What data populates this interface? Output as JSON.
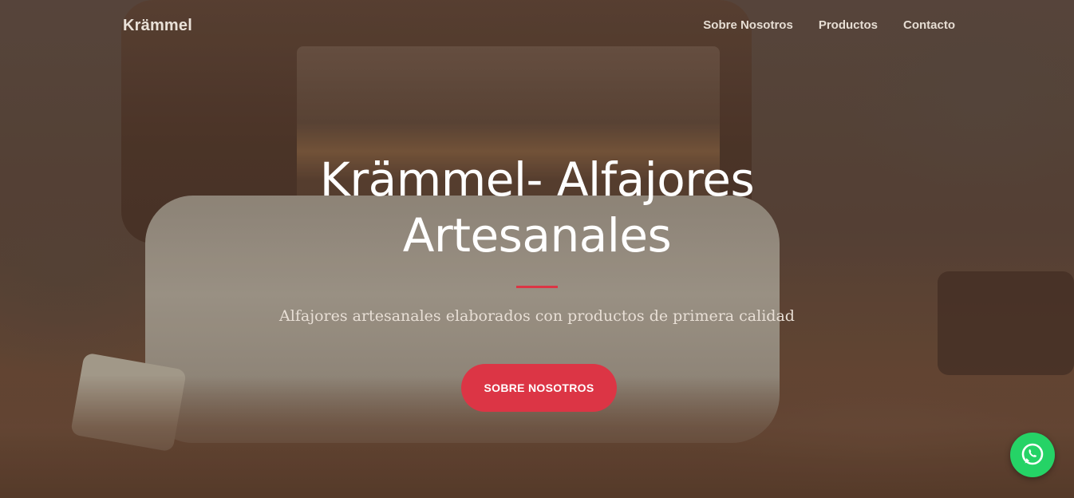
{
  "nav": {
    "brand": "Krämmel",
    "links": [
      {
        "label": "Sobre Nosotros"
      },
      {
        "label": "Productos"
      },
      {
        "label": "Contacto"
      }
    ]
  },
  "hero": {
    "title": "Krämmel- Alfajores Artesanales",
    "subtitle": "Alfajores artesanales elaborados con productos de primera calidad",
    "cta_label": "SOBRE NOSOTROS"
  },
  "floating": {
    "whatsapp_icon": "whatsapp-icon"
  },
  "colors": {
    "accent": "#dc3545",
    "whatsapp": "#25d366"
  }
}
